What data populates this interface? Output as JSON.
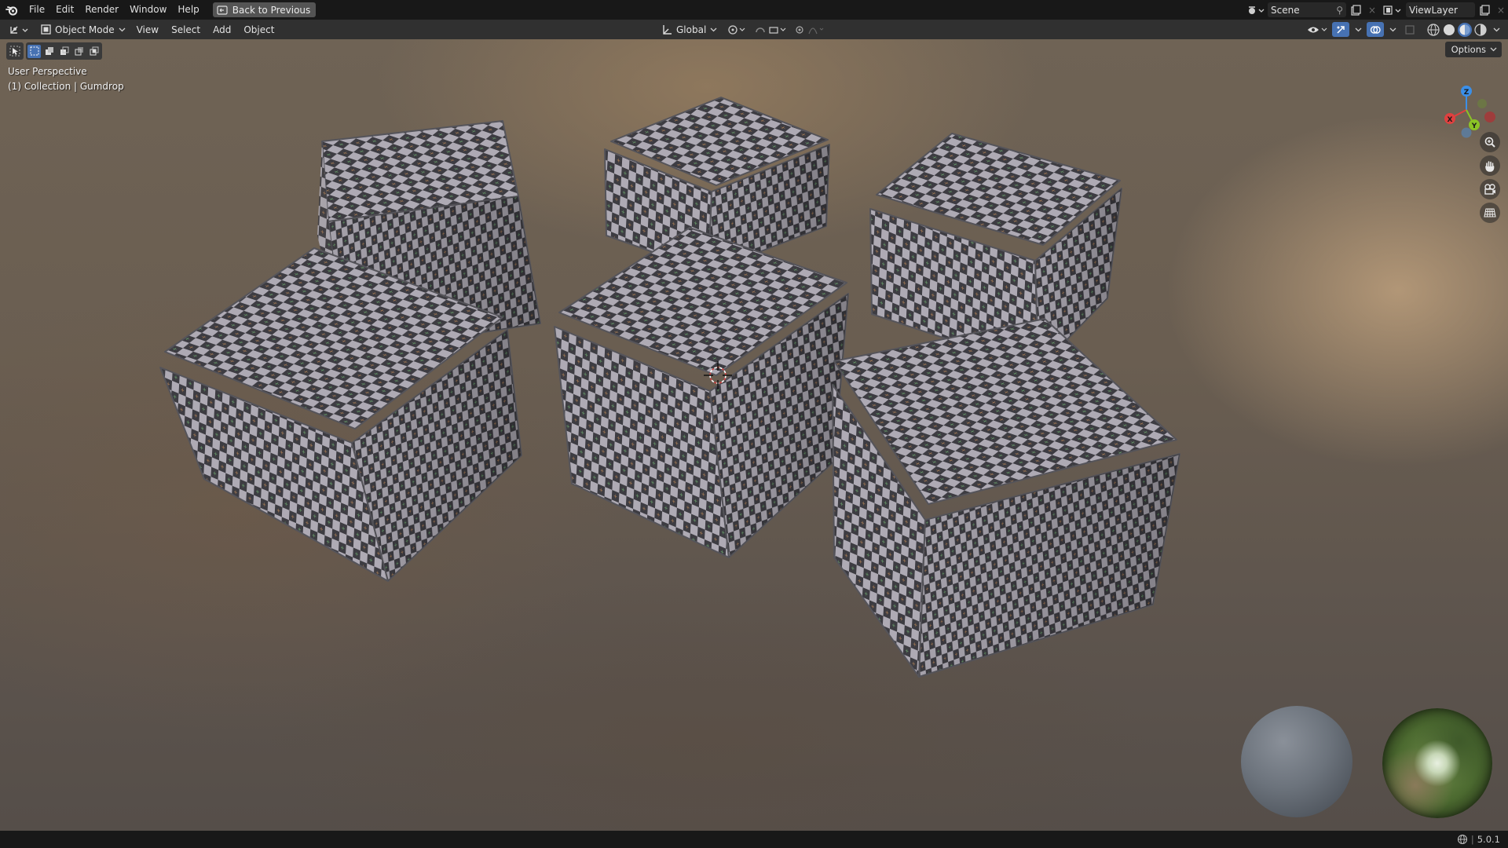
{
  "topbar": {
    "menus": [
      "File",
      "Edit",
      "Render",
      "Window",
      "Help"
    ],
    "back_button": "Back to Previous",
    "scene_name": "Scene",
    "view_layer": "ViewLayer"
  },
  "header": {
    "mode": "Object Mode",
    "menus": [
      "View",
      "Select",
      "Add",
      "Object"
    ],
    "transform_orientation": "Global"
  },
  "viewport": {
    "view_name": "User Perspective",
    "collection_info": "(1) Collection | Gumdrop",
    "options_label": "Options",
    "gizmo": {
      "x": "X",
      "y": "Y",
      "z": "Z"
    }
  },
  "statusbar": {
    "version": "5.0.1"
  },
  "colors": {
    "checker_light": "#aeaab4",
    "checker_dark": "#3d3c42",
    "axis_x": "#e0403f",
    "axis_y": "#8bc326",
    "axis_z": "#3b8fe8"
  }
}
